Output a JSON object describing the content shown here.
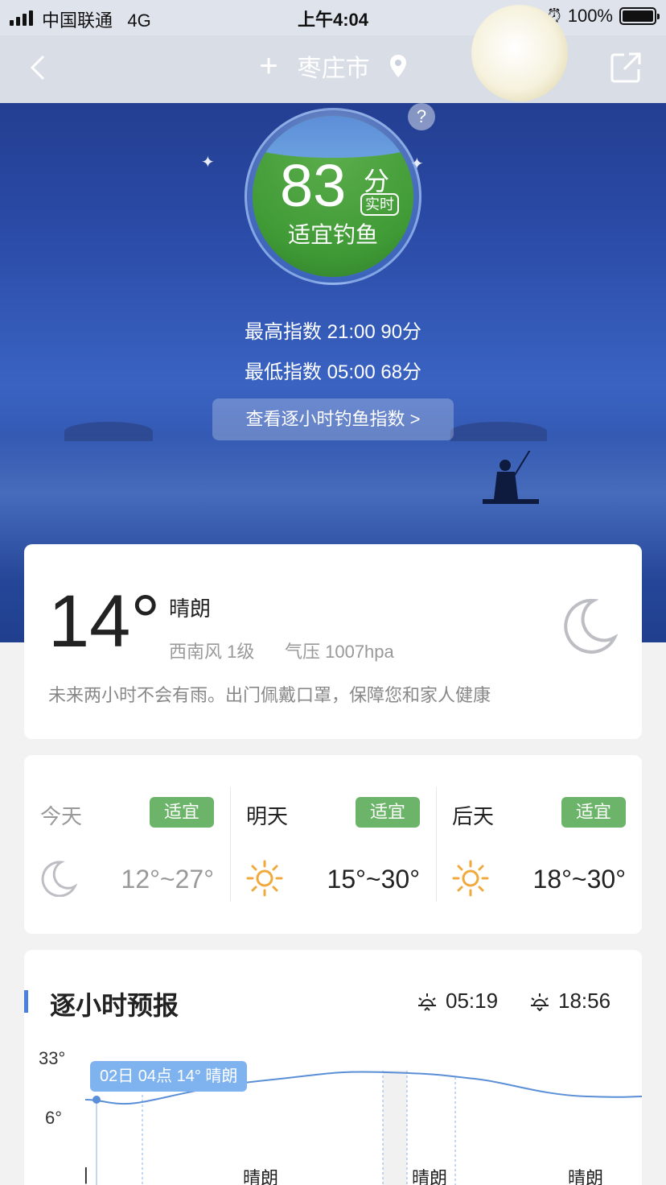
{
  "status_bar": {
    "carrier": "中国联通",
    "network": "4G",
    "time": "上午4:04",
    "battery": "100%"
  },
  "header": {
    "city": "枣庄市"
  },
  "fishing": {
    "score": "83",
    "score_unit": "分",
    "realtime_badge": "实时",
    "suitability": "适宜钓鱼",
    "max_index": "最高指数 21:00 90分",
    "min_index": "最低指数 05:00 68分",
    "hourly_link": "查看逐小时钓鱼指数 >",
    "help": "?"
  },
  "current": {
    "temperature": "14°",
    "condition": "晴朗",
    "wind": "西南风 1级",
    "pressure": "气压 1007hpa",
    "tip": "未来两小时不会有雨。出门佩戴口罩，保障您和家人健康"
  },
  "forecast": [
    {
      "day": "今天",
      "badge": "适宜",
      "icon": "moon-icon",
      "temp": "12°~27°",
      "muted": true
    },
    {
      "day": "明天",
      "badge": "适宜",
      "icon": "sun-icon",
      "temp": "15°~30°",
      "muted": false
    },
    {
      "day": "后天",
      "badge": "适宜",
      "icon": "sun-icon",
      "temp": "18°~30°",
      "muted": false
    }
  ],
  "hourly": {
    "title": "逐小时预报",
    "sunrise": "05:19",
    "sunset": "18:56",
    "y_max": "33°",
    "y_min": "6°",
    "tooltip": "02日 04点 14° 晴朗",
    "conditions": [
      "晴朗",
      "晴朗",
      "晴朗"
    ],
    "first_marker": "|"
  },
  "colors": {
    "accent_blue": "#4a7fe0",
    "badge_green": "#6bb46a",
    "score_green": "#3f9a35"
  }
}
